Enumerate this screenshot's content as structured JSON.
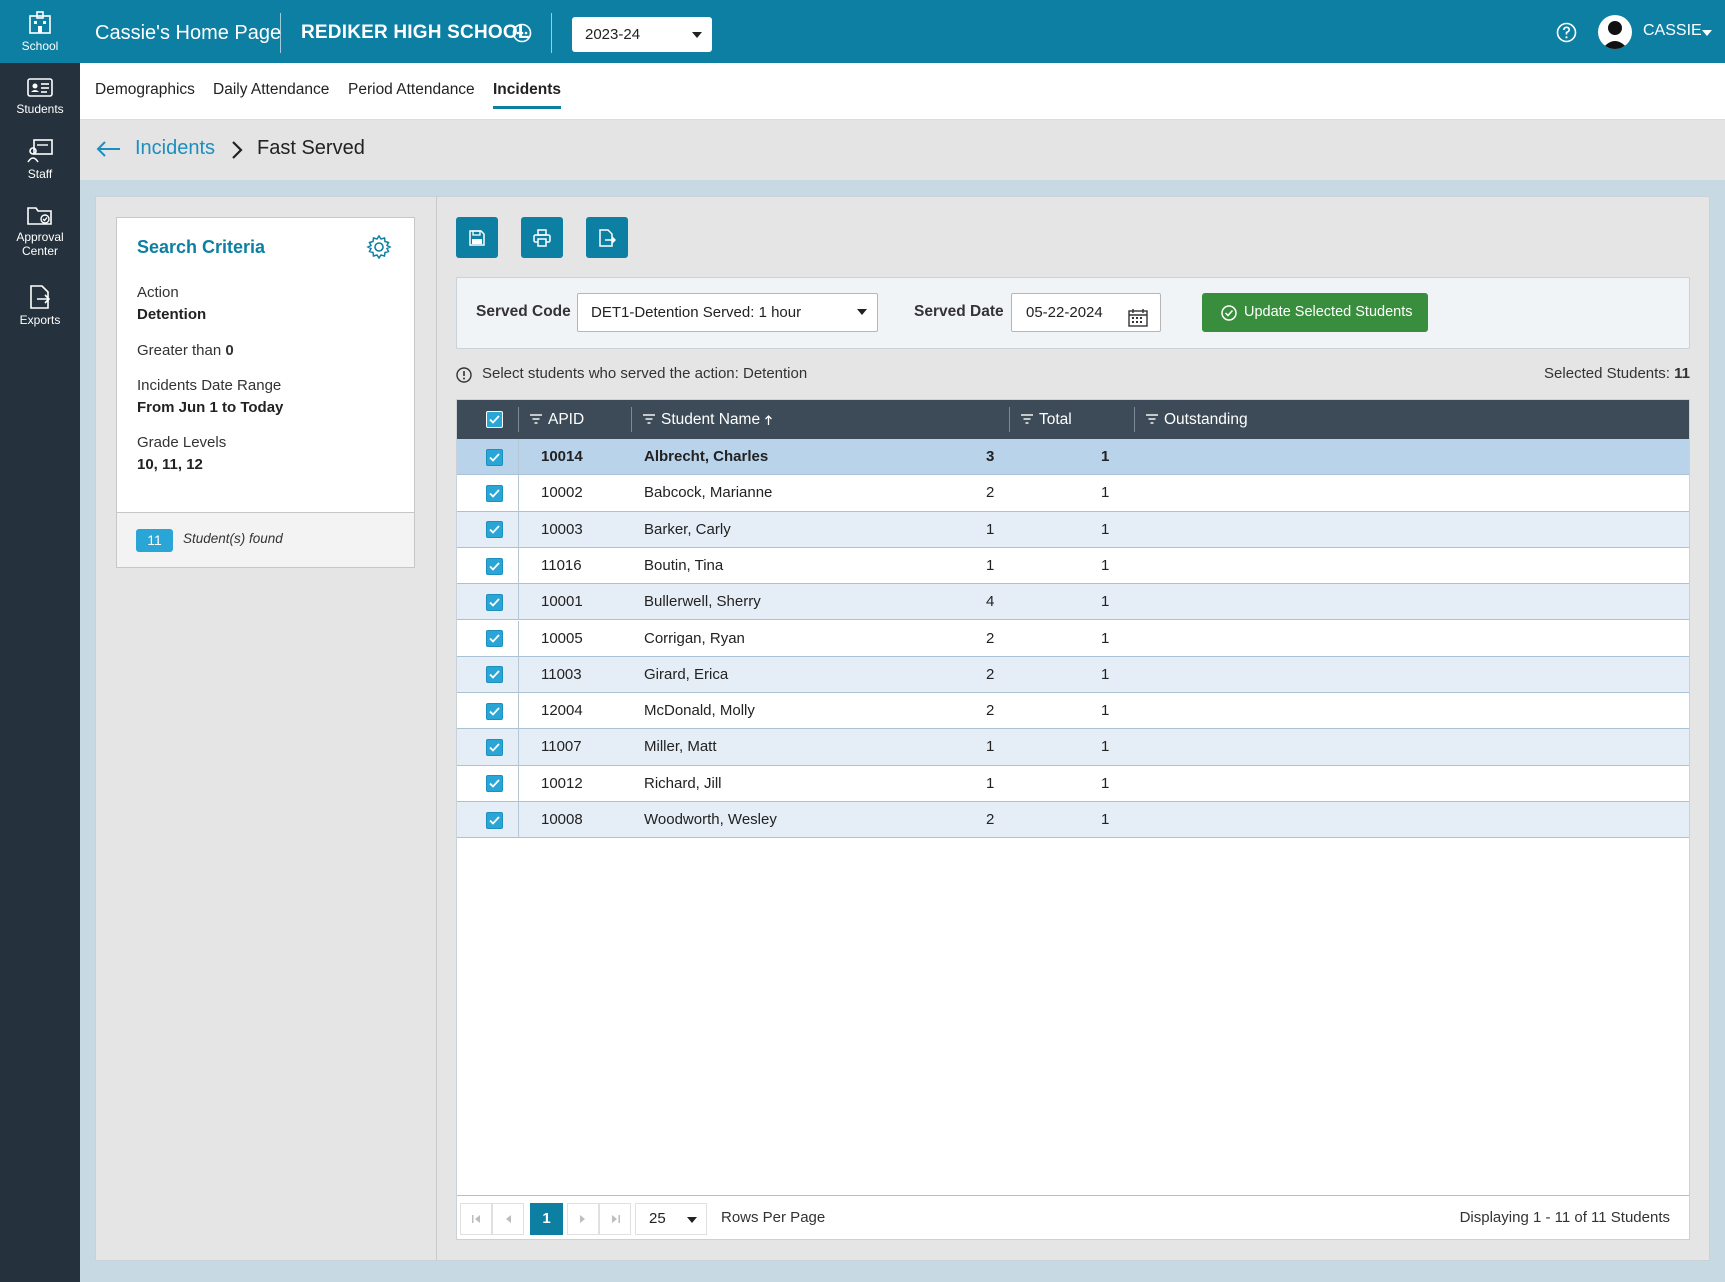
{
  "rail": {
    "items": [
      {
        "label": "School",
        "icon": "school-icon"
      },
      {
        "label": "Students",
        "icon": "students-icon"
      },
      {
        "label": "Staff",
        "icon": "staff-icon"
      },
      {
        "label": "Approval",
        "label2": "Center",
        "icon": "approval-center-icon"
      },
      {
        "label": "Exports",
        "icon": "exports-icon"
      }
    ]
  },
  "topbar": {
    "home_title": "Cassie's Home Page",
    "school_name": "REDIKER HIGH SCHOOL",
    "year": "2023-24",
    "user": "CASSIE"
  },
  "tabs": [
    "Demographics",
    "Daily Attendance",
    "Period Attendance",
    "Incidents"
  ],
  "breadcrumb": {
    "parent": "Incidents",
    "current": "Fast Served"
  },
  "criteria": {
    "title": "Search Criteria",
    "action_label": "Action",
    "action_value": "Detention",
    "greater_label": "Greater than",
    "greater_value": "0",
    "range_label": "Incidents Date Range",
    "range_value": "From Jun 1 to Today",
    "grades_label": "Grade Levels",
    "grades_value": "10, 11, 12",
    "count": "11",
    "found_text": "Student(s) found"
  },
  "filters": {
    "served_code_label": "Served Code",
    "served_code_value": "DET1-Detention Served: 1 hour",
    "served_date_label": "Served Date",
    "served_date_value": "05-22-2024",
    "update_button": "Update Selected Students"
  },
  "info": {
    "message": "Select students who served the action: Detention",
    "selected_label": "Selected Students:",
    "selected_count": "11"
  },
  "grid": {
    "columns": [
      "APID",
      "Student Name",
      "Total",
      "Outstanding"
    ],
    "rows": [
      {
        "apid": "10014",
        "name": "Albrecht, Charles",
        "total": "3",
        "outstanding": "1"
      },
      {
        "apid": "10002",
        "name": "Babcock, Marianne",
        "total": "2",
        "outstanding": "1"
      },
      {
        "apid": "10003",
        "name": "Barker, Carly",
        "total": "1",
        "outstanding": "1"
      },
      {
        "apid": "11016",
        "name": "Boutin, Tina",
        "total": "1",
        "outstanding": "1"
      },
      {
        "apid": "10001",
        "name": "Bullerwell, Sherry",
        "total": "4",
        "outstanding": "1"
      },
      {
        "apid": "10005",
        "name": "Corrigan, Ryan",
        "total": "2",
        "outstanding": "1"
      },
      {
        "apid": "11003",
        "name": "Girard, Erica",
        "total": "2",
        "outstanding": "1"
      },
      {
        "apid": "12004",
        "name": "McDonald, Molly",
        "total": "2",
        "outstanding": "1"
      },
      {
        "apid": "11007",
        "name": "Miller, Matt",
        "total": "1",
        "outstanding": "1"
      },
      {
        "apid": "10012",
        "name": "Richard, Jill",
        "total": "1",
        "outstanding": "1"
      },
      {
        "apid": "10008",
        "name": "Woodworth, Wesley",
        "total": "2",
        "outstanding": "1"
      }
    ]
  },
  "pager": {
    "current_page": "1",
    "rows_per_page": "25",
    "rows_per_page_label": "Rows Per Page",
    "displaying": "Displaying 1 - 11 of 11 Students"
  },
  "colors": {
    "brand": "#0d7fa3",
    "rail": "#25323d",
    "success": "#388e3c",
    "accent": "#2aa6d6"
  }
}
